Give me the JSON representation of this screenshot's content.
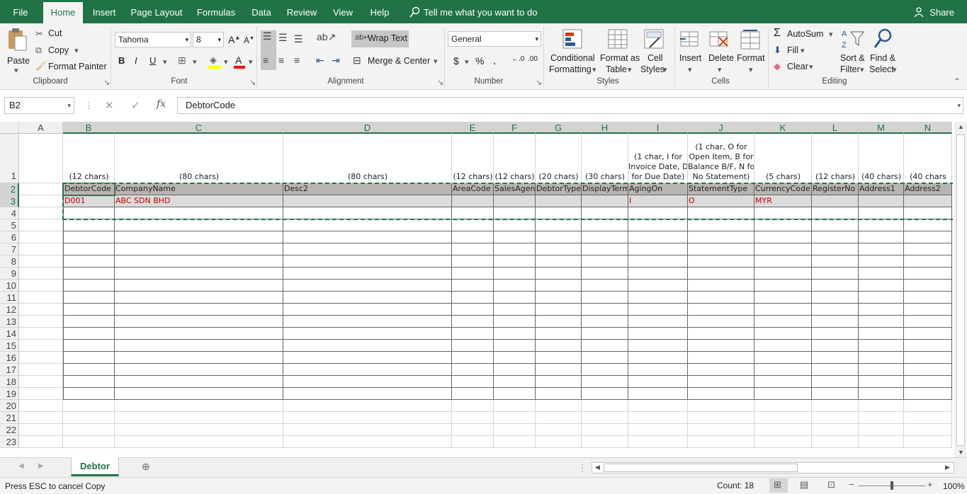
{
  "menu": {
    "tabs": [
      "File",
      "Home",
      "Insert",
      "Page Layout",
      "Formulas",
      "Data",
      "Review",
      "View",
      "Help"
    ],
    "active": "Home",
    "tell_me": "Tell me what you want to do",
    "share": "Share"
  },
  "ribbon": {
    "clipboard": {
      "label": "Clipboard",
      "paste": "Paste",
      "cut": "Cut",
      "copy": "Copy",
      "format_painter": "Format Painter"
    },
    "font": {
      "label": "Font",
      "name": "Tahoma",
      "size": "8"
    },
    "alignment": {
      "label": "Alignment",
      "wrap_text": "Wrap Text",
      "merge_center": "Merge & Center"
    },
    "number": {
      "label": "Number",
      "format": "General"
    },
    "styles": {
      "label": "Styles",
      "conditional1": "Conditional",
      "conditional2": "Formatting",
      "format_as1": "Format as",
      "format_as2": "Table",
      "cell_styles1": "Cell",
      "cell_styles2": "Styles"
    },
    "cells": {
      "label": "Cells",
      "insert": "Insert",
      "delete": "Delete",
      "format": "Format"
    },
    "editing": {
      "label": "Editing",
      "autosum": "AutoSum",
      "fill": "Fill",
      "clear": "Clear",
      "sort1": "Sort &",
      "sort2": "Filter",
      "find1": "Find &",
      "find2": "Select"
    }
  },
  "formula_bar": {
    "name_box": "B2",
    "formula": "DebtorCode"
  },
  "sheet": {
    "columns": [
      "A",
      "B",
      "C",
      "D",
      "E",
      "F",
      "G",
      "H",
      "I",
      "J",
      "K",
      "L",
      "M",
      "N"
    ],
    "rows": [
      "1",
      "2",
      "3",
      "4",
      "5",
      "6",
      "7",
      "8",
      "9",
      "10",
      "11",
      "12",
      "13",
      "14",
      "15",
      "16",
      "17",
      "18",
      "19",
      "20",
      "21",
      "22",
      "23"
    ],
    "notes": [
      "",
      "(12 chars)",
      "(80 chars)",
      "(80 chars)",
      "(12 chars)",
      "(12 chars)",
      "(20 chars)",
      "(30 chars)",
      "",
      "",
      "(5 chars)",
      "(12 chars)",
      "(40 chars)",
      "(40 chars"
    ],
    "note_i": [
      "(1 char, I for",
      "Invoice Date, D",
      "for Due Date)"
    ],
    "note_j": [
      "(1 char, O for",
      "Open Item, B for",
      "Balance B/F, N for",
      "No Statement)"
    ],
    "headers": [
      "",
      "DebtorCode",
      "CompanyName",
      "Desc2",
      "AreaCode",
      "SalesAgent",
      "DebtorType",
      "DisplayTerm",
      "AgingOn",
      "StatementType",
      "CurrencyCode",
      "RegisterNo",
      "Address1",
      "Address2"
    ],
    "row3": [
      "",
      "D001",
      "ABC SDN BHD",
      "",
      "",
      "",
      "",
      "",
      "I",
      "O",
      "MYR",
      "",
      "",
      ""
    ]
  },
  "sheet_tab": "Debtor",
  "status": {
    "message": "Press ESC to cancel Copy",
    "count": "Count: 18",
    "zoom": "100%"
  }
}
